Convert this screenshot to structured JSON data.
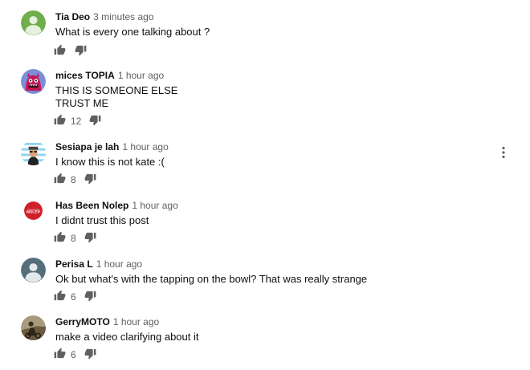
{
  "colors": {
    "author": "#0f0f0f",
    "meta": "#606060",
    "icon": "#606060"
  },
  "icons": {
    "like": "thumb-up-icon",
    "dislike": "thumb-down-icon",
    "more": "vertical-dots-icon"
  },
  "comments": [
    {
      "author": "Tia Deo",
      "time": "3 minutes ago",
      "lines": [
        "What is every one talking about ?"
      ],
      "likes": "",
      "avatar": "default-green-avatar"
    },
    {
      "author": "mices TOPIA",
      "time": "1 hour ago",
      "lines": [
        "THIS IS SOMEONE ELSE",
        "TRUST ME"
      ],
      "likes": "12",
      "avatar": "pink-monster-avatar"
    },
    {
      "author": "Sesiapa je lah",
      "time": "1 hour ago",
      "lines": [
        "I know this is not kate :("
      ],
      "likes": "8",
      "avatar": "striped-character-avatar"
    },
    {
      "author": "Has Been Nolep",
      "time": "1 hour ago",
      "lines": [
        "I didnt trust this post"
      ],
      "likes": "8",
      "avatar": "red-badge-avatar",
      "avatar_text": "NOLEP"
    },
    {
      "author": "Perisa L",
      "time": "1 hour ago",
      "lines": [
        "Ok but what's with the tapping on the bowl? That was really strange"
      ],
      "likes": "6",
      "avatar": "default-slate-avatar"
    },
    {
      "author": "GerryMOTO",
      "time": "1 hour ago",
      "lines": [
        "make a video clarifying about it"
      ],
      "likes": "6",
      "avatar": "photo-avatar"
    }
  ]
}
